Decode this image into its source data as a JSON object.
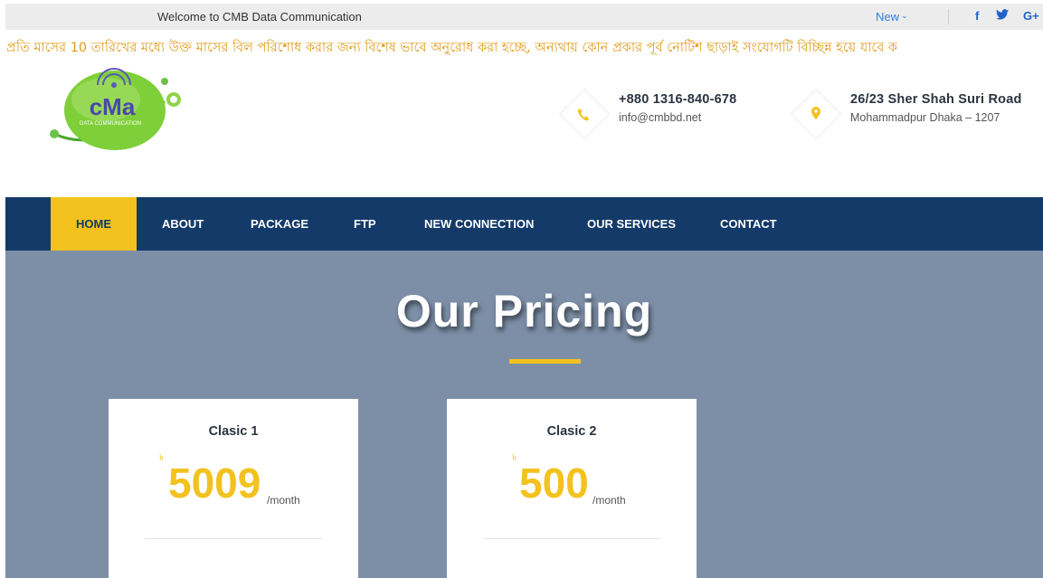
{
  "topbar": {
    "welcome": "Welcome to CMB Data Communication",
    "new_label": "New",
    "social": [
      "f",
      "t",
      "G+"
    ]
  },
  "notice": "প্রতি মাসের 10 তারিখের মধ্যে উক্ত মাসের বিল পরিশোধ করার জন্য বিশেষ ভাবে অনুরোধ করা হচ্ছে, অন্যথায় কোন প্রকার পূর্ব নোটিশ ছাড়াই সংযোগটি বিচ্ছিন্ন হয়ে যাবে ক",
  "logo": {
    "text": "cMa",
    "subtext": "DATA COMMUNICATION"
  },
  "contact": {
    "phone": "+880 1316-840-678",
    "email": "info@cmbbd.net",
    "address_line1": "26/23 Sher Shah Suri Road",
    "address_line2": "Mohammadpur Dhaka – 1207"
  },
  "nav": {
    "items": [
      "HOME",
      "ABOUT",
      "PACKAGE",
      "FTP",
      "NEW CONNECTION",
      "OUR SERVICES",
      "CONTACT"
    ],
    "active": "HOME"
  },
  "pricing": {
    "heading": "Our Pricing",
    "plans": [
      {
        "name": "Clasic 1",
        "currency": "৳",
        "price": "5009",
        "period": "/month"
      },
      {
        "name": "Clasic 2",
        "currency": "৳",
        "price": "500",
        "period": "/month"
      }
    ]
  },
  "colors": {
    "accent": "#f3c21e",
    "nav_bg": "#133a69",
    "section_bg": "#7d8fa7",
    "notice": "#e09a16"
  }
}
